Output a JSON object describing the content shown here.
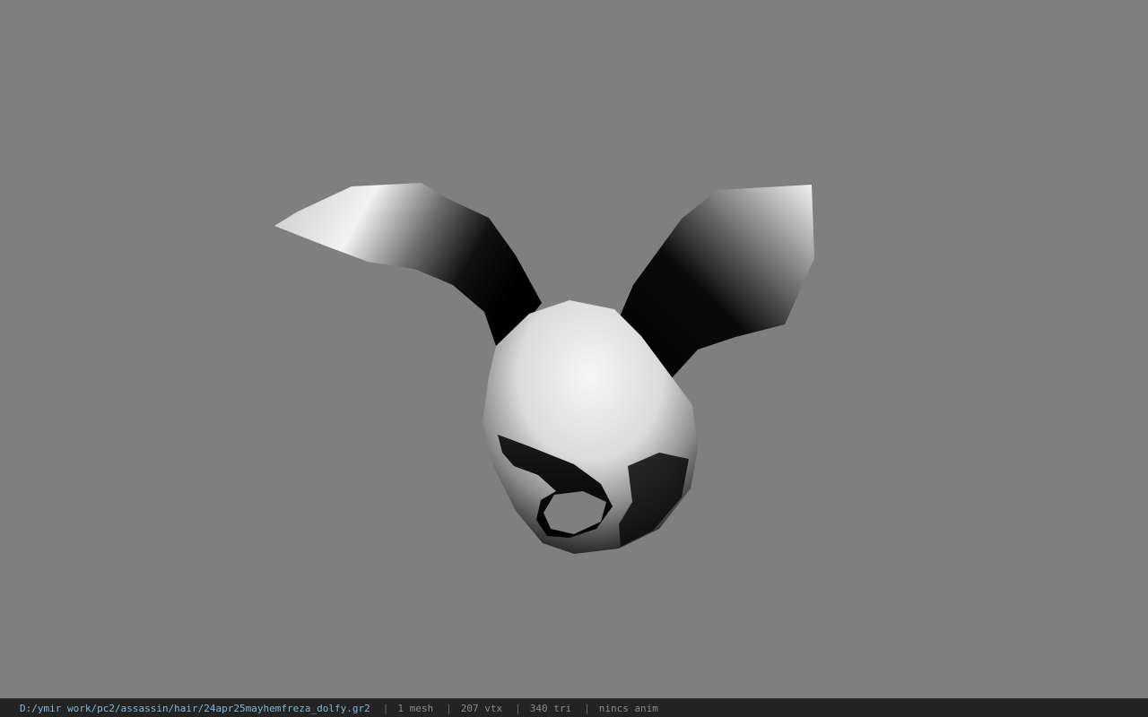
{
  "viewport": {
    "background": "#7f7f7f",
    "model_name": "hair-mesh-bunny-ears"
  },
  "statusbar": {
    "file_path": "D:/ymir work/pc2/assassin/hair/24apr25mayhemfreza_dolfy.gr2",
    "separator": "|",
    "mesh_count": "1 mesh",
    "vertex_count": "207 vtx",
    "triangle_count": "340 tri",
    "animation": "nincs anim"
  },
  "colors": {
    "statusbar_bg": "#232323",
    "path_text": "#7fb6d8",
    "stat_text": "#8a8a8a"
  }
}
